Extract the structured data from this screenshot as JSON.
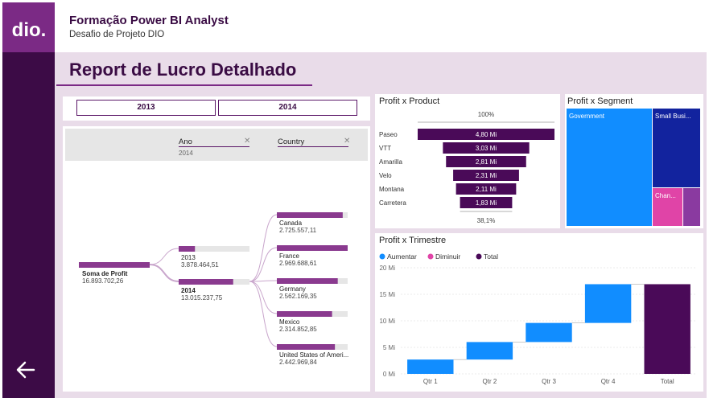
{
  "app": {
    "title": "Formação Power BI Analyst",
    "subtitle": "Desafio de Projeto DIO",
    "logo_text": "dio."
  },
  "report": {
    "title": "Report de Lucro Detalhado"
  },
  "slicer": {
    "options": [
      "2013",
      "2014"
    ]
  },
  "decomp": {
    "filters": [
      {
        "label": "Ano",
        "value": "2014"
      },
      {
        "label": "Country",
        "value": ""
      }
    ],
    "root": {
      "label": "Soma de Profit",
      "value": "16.893.702,26"
    },
    "years": [
      {
        "label": "2013",
        "value": "3.878.464,51",
        "fraction": 0.23
      },
      {
        "label": "2014",
        "value": "13.015.237,75",
        "fraction": 0.77
      }
    ],
    "countries": [
      {
        "label": "Canada",
        "value": "2.725.557,11",
        "fraction": 0.93
      },
      {
        "label": "France",
        "value": "2.969.688,61",
        "fraction": 1.0
      },
      {
        "label": "Germany",
        "value": "2.562.169,35",
        "fraction": 0.86
      },
      {
        "label": "Mexico",
        "value": "2.314.852,85",
        "fraction": 0.78
      },
      {
        "label": "United States of Ameri...",
        "value": "2.442.969,84",
        "fraction": 0.82
      }
    ]
  },
  "funnel": {
    "title": "Profit x Product",
    "top_pct": "100%",
    "bottom_pct": "38,1%",
    "color": "#4a0a58",
    "items": [
      {
        "label": "Paseo",
        "value": 4.8,
        "text": "4,80 Mi"
      },
      {
        "label": "VTT",
        "value": 3.03,
        "text": "3,03 Mi"
      },
      {
        "label": "Amarilla",
        "value": 2.81,
        "text": "2,81 Mi"
      },
      {
        "label": "Velo",
        "value": 2.31,
        "text": "2,31 Mi"
      },
      {
        "label": "Montana",
        "value": 2.11,
        "text": "2,11 Mi"
      },
      {
        "label": "Carretera",
        "value": 1.83,
        "text": "1,83 Mi"
      }
    ]
  },
  "treemap": {
    "title": "Profit x Segment",
    "items": [
      {
        "label": "Government",
        "color": "#118dff"
      },
      {
        "label": "Small Busi...",
        "color": "#12239e"
      },
      {
        "label": "Chan...",
        "color": "#e044a7"
      },
      {
        "label": "",
        "color": "#8a3aa0"
      }
    ]
  },
  "chart_data": {
    "type": "waterfall",
    "title": "Profit x Trimestre",
    "legend": [
      {
        "name": "Aumentar",
        "color": "#118dff"
      },
      {
        "name": "Diminuir",
        "color": "#e044a7"
      },
      {
        "name": "Total",
        "color": "#4a0a58"
      }
    ],
    "categories": [
      "Qtr 1",
      "Qtr 2",
      "Qtr 3",
      "Qtr 4",
      "Total"
    ],
    "values": [
      2.7,
      3.3,
      3.6,
      7.3,
      16.9
    ],
    "is_total": [
      false,
      false,
      false,
      false,
      true
    ],
    "yticks": [
      "0 Mi",
      "5 Mi",
      "10 Mi",
      "15 Mi",
      "20 Mi"
    ],
    "ylim": [
      0,
      20
    ],
    "grid": true,
    "legend_position": "top-left"
  }
}
